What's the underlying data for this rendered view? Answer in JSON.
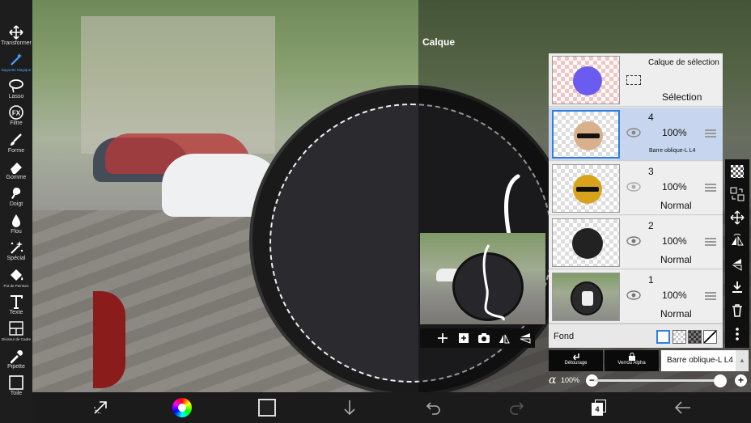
{
  "toolbar": {
    "tools": [
      {
        "label": "Transformer",
        "icon": "move-icon"
      },
      {
        "label": "Baguette Magique",
        "icon": "magic-wand-icon",
        "active": true
      },
      {
        "label": "Lasso",
        "icon": "lasso-icon"
      },
      {
        "label": "Filtre",
        "icon": "fx-icon"
      },
      {
        "label": "Forme",
        "icon": "brush-icon"
      },
      {
        "label": "Gomme",
        "icon": "eraser-icon"
      },
      {
        "label": "Doigt",
        "icon": "smudge-icon"
      },
      {
        "label": "Flou",
        "icon": "blur-drop-icon"
      },
      {
        "label": "Spécial",
        "icon": "sparkle-icon"
      },
      {
        "label": "Pot de Peinture",
        "icon": "paint-bucket-icon"
      },
      {
        "label": "Texte",
        "icon": "text-icon"
      },
      {
        "label": "Diviseur de Cadre",
        "icon": "frame-divider-icon"
      },
      {
        "label": "Pipette",
        "icon": "eyedropper-icon"
      },
      {
        "label": "Toile",
        "icon": "canvas-icon"
      }
    ]
  },
  "panel": {
    "title": "Calque",
    "selection_layer": {
      "title": "Calque de sélection",
      "label": "Sélection"
    },
    "layers": [
      {
        "number": "4",
        "opacity": "100%",
        "mode": "Barre oblique-L L4",
        "selected": true
      },
      {
        "number": "3",
        "opacity": "100%",
        "mode": "Normal"
      },
      {
        "number": "2",
        "opacity": "100%",
        "mode": "Normal"
      },
      {
        "number": "1",
        "opacity": "100%",
        "mode": "Normal"
      }
    ],
    "background_label": "Fond",
    "clipping_label": "Détourage",
    "alpha_lock_label": "Verrou Alpha",
    "blend_mode_value": "Barre oblique-L L4",
    "alpha_symbol": "α",
    "alpha_value": "100%",
    "alpha_level": 1.0,
    "minus": "−",
    "plus": "+"
  },
  "bottom": {
    "layer_count": "4"
  },
  "colors": {
    "accent": "#4aa3ff",
    "selected_layer_bg": "#c7d6ee",
    "panel_bg": "#e8e8e8"
  }
}
